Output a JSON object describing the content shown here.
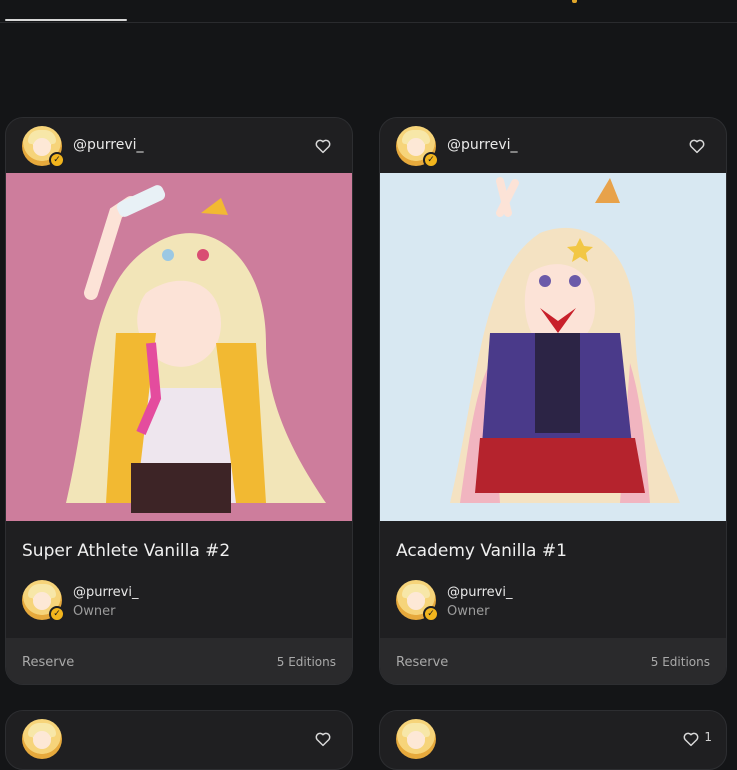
{
  "cards": [
    {
      "creator": "@purrevi_",
      "title": "Super Athlete Vanilla #2",
      "owner_handle": "@purrevi_",
      "owner_role": "Owner",
      "reserve_label": "Reserve",
      "editions": "5 Editions",
      "art_color": "#cd7d9c",
      "icons": [
        "heart-icon",
        "verified-icon"
      ]
    },
    {
      "creator": "@purrevi_",
      "title": "Academy Vanilla #1",
      "owner_handle": "@purrevi_",
      "owner_role": "Owner",
      "reserve_label": "Reserve",
      "editions": "5 Editions",
      "art_color": "#d8e8f2",
      "icons": [
        "heart-icon",
        "verified-icon"
      ]
    }
  ],
  "partial_cards": [
    {
      "like_count": ""
    },
    {
      "like_count": "1"
    }
  ],
  "colors": {
    "background": "#141517",
    "card": "#1f1f21",
    "verified": "#f2b51d",
    "accent": "#e0a62a"
  }
}
